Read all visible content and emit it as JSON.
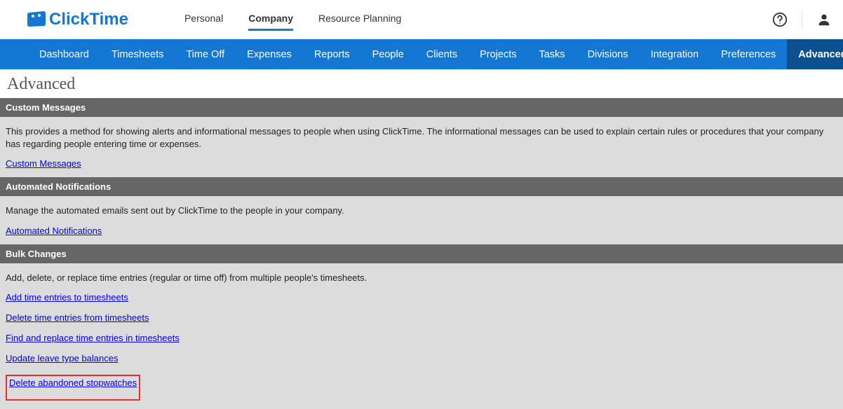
{
  "logo_text": "ClickTime",
  "top_tabs": {
    "personal": "Personal",
    "company": "Company",
    "resource_planning": "Resource Planning"
  },
  "nav": {
    "dashboard": "Dashboard",
    "timesheets": "Timesheets",
    "time_off": "Time Off",
    "expenses": "Expenses",
    "reports": "Reports",
    "people": "People",
    "clients": "Clients",
    "projects": "Projects",
    "tasks": "Tasks",
    "divisions": "Divisions",
    "integration": "Integration",
    "preferences": "Preferences",
    "advanced": "Advanced"
  },
  "page_title": "Advanced",
  "sections": {
    "custom_messages": {
      "header": "Custom Messages",
      "desc": "This provides a method for showing alerts and informational messages to people when using ClickTime. The informational messages can be used to explain certain rules or procedures that your company has regarding people entering time or expenses.",
      "link": "Custom Messages"
    },
    "automated_notifications": {
      "header": "Automated Notifications",
      "desc": "Manage the automated emails sent out by ClickTime to the people in your company.",
      "link": "Automated Notifications"
    },
    "bulk_changes": {
      "header": "Bulk Changes",
      "desc": "Add, delete, or replace time entries (regular or time off) from multiple people's timesheets.",
      "links": {
        "add": "Add time entries to timesheets",
        "delete": "Delete time entries from timesheets",
        "find_replace": "Find and replace time entries in timesheets",
        "update_leave": "Update leave type balances",
        "delete_stopwatches": "Delete abandoned stopwatches"
      }
    }
  }
}
